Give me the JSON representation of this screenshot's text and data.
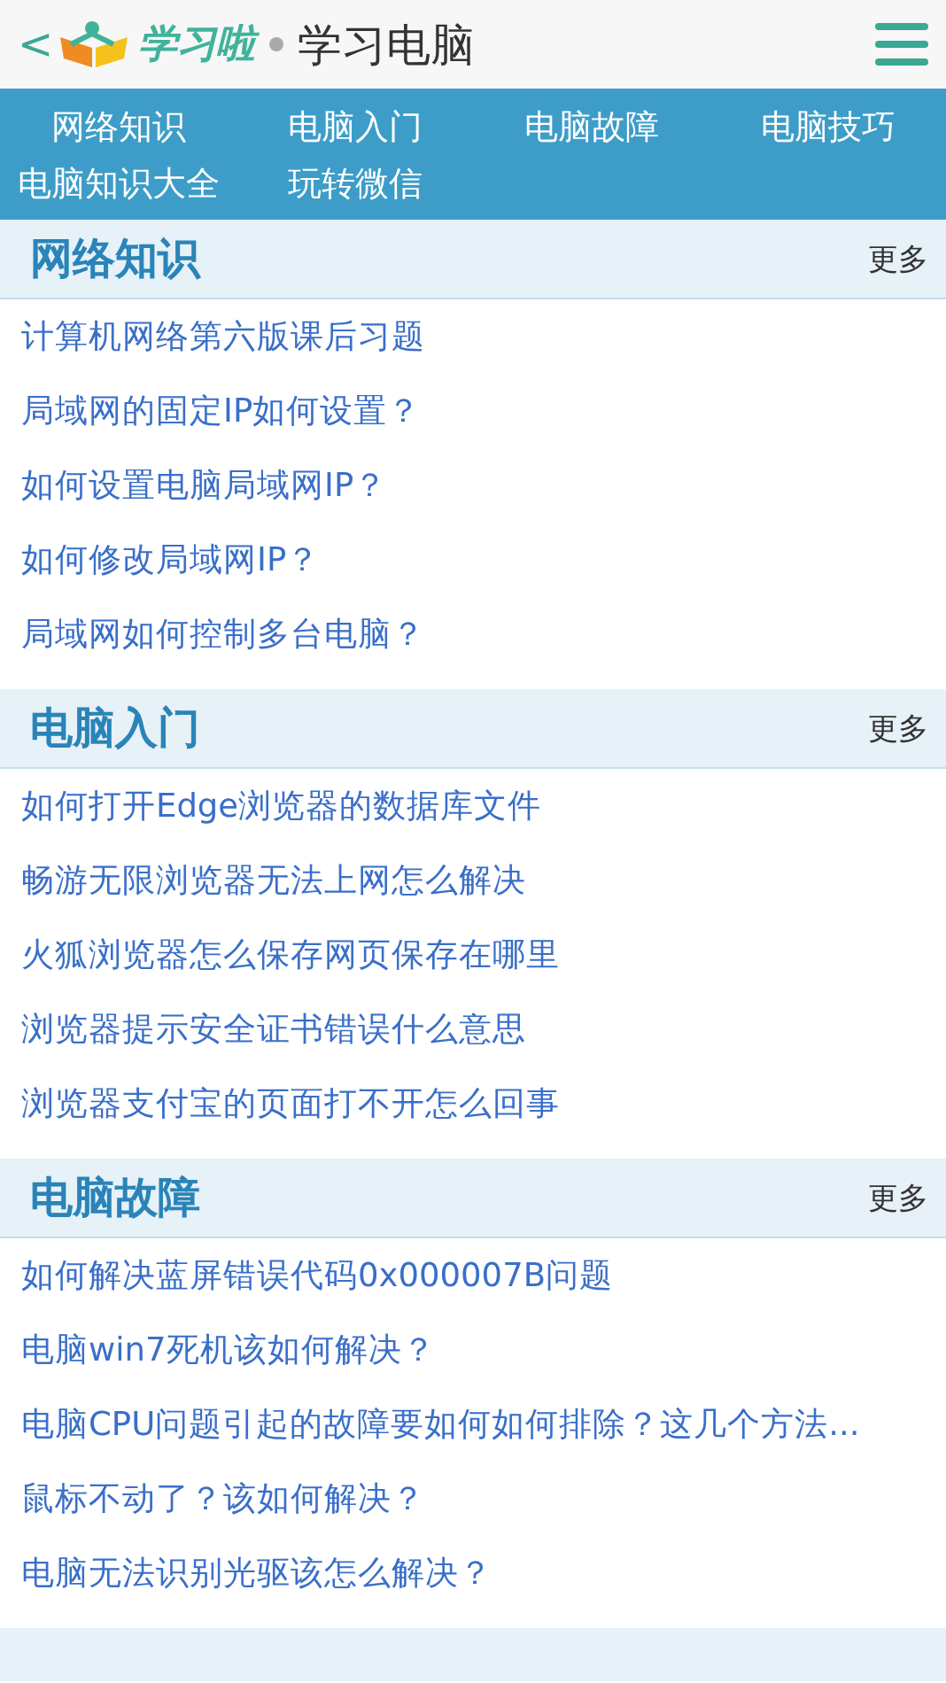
{
  "header": {
    "back": "<",
    "logo": "学习啦",
    "title": "学习电脑"
  },
  "nav": [
    {
      "label": "网络知识"
    },
    {
      "label": "电脑入门"
    },
    {
      "label": "电脑故障"
    },
    {
      "label": "电脑技巧"
    },
    {
      "label": "电脑知识大全"
    },
    {
      "label": "玩转微信"
    }
  ],
  "sections": [
    {
      "title": "网络知识",
      "more": "更多",
      "items": [
        "计算机网络第六版课后习题",
        "局域网的固定IP如何设置？",
        "如何设置电脑局域网IP？",
        "如何修改局域网IP？",
        "局域网如何控制多台电脑？"
      ]
    },
    {
      "title": "电脑入门",
      "more": "更多",
      "items": [
        "如何打开Edge浏览器的数据库文件",
        "畅游无限浏览器无法上网怎么解决",
        "火狐浏览器怎么保存网页保存在哪里",
        "浏览器提示安全证书错误什么意思",
        "浏览器支付宝的页面打不开怎么回事"
      ]
    },
    {
      "title": "电脑故障",
      "more": "更多",
      "items": [
        "如何解决蓝屏错误代码0x000007B问题",
        "电脑win7死机该如何解决？",
        "电脑CPU问题引起的故障要如何如何排除？这几个方法...",
        "鼠标不动了？该如何解决？",
        "电脑无法识别光驱该怎么解决？"
      ]
    }
  ]
}
